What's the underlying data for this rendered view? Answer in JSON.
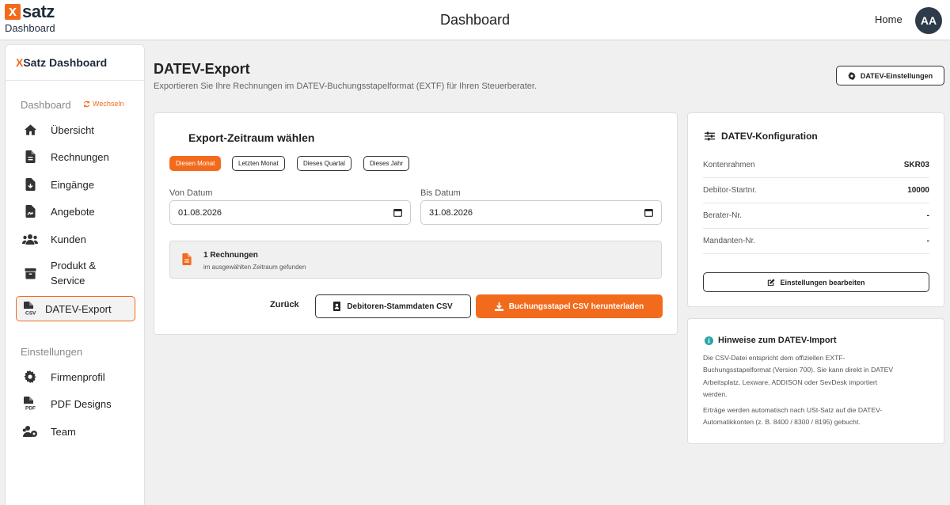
{
  "brand": {
    "logo_letter": "x",
    "logo_word": "satz",
    "subtitle": "Dashboard"
  },
  "topbar": {
    "title": "Dashboard",
    "home": "Home",
    "avatar": "AA"
  },
  "sidebar": {
    "header_x": "X",
    "header_rest": "Satz Dashboard",
    "section_dashboard": "Dashboard",
    "switch_label": "Wechseln",
    "items": [
      {
        "label": "Übersicht",
        "icon": "home-icon"
      },
      {
        "label": "Rechnungen",
        "icon": "file-icon"
      },
      {
        "label": "Eingänge",
        "icon": "file-download-icon"
      },
      {
        "label": "Angebote",
        "icon": "file-signature-icon"
      },
      {
        "label": "Kunden",
        "icon": "users-icon"
      },
      {
        "label_line1": "Produkt &",
        "label_line2": "Service",
        "icon": "box-icon"
      },
      {
        "label": "DATEV-Export",
        "icon": "file-csv-icon",
        "active": true
      }
    ],
    "section_settings": "Einstellungen",
    "settings_items": [
      {
        "label": "Firmenprofil",
        "icon": "gear-icon"
      },
      {
        "label": "PDF Designs",
        "icon": "file-pdf-icon"
      },
      {
        "label": "Team",
        "icon": "team-icon"
      }
    ]
  },
  "page": {
    "title": "DATEV-Export",
    "subtitle": "Exportieren Sie Ihre Rechnungen im DATEV-Buchungsstapelformat (EXTF) für Ihren Steuerberater.",
    "settings_button": "DATEV-Einstellungen"
  },
  "export": {
    "title": "Export-Zeitraum wählen",
    "chips": [
      "Diesen Monat",
      "Letzten Monat",
      "Dieses Quartal",
      "Dieses Jahr"
    ],
    "active_chip": 0,
    "from_label": "Von Datum",
    "from_value": "01.08.2026",
    "to_label": "Bis Datum",
    "to_value": "31.08.2026",
    "found_title": "1 Rechnungen",
    "found_sub": "im ausgewählten Zeitraum gefunden",
    "back": "Zurück",
    "csv_button": "Debitoren-Stammdaten CSV",
    "download_button": "Buchungsstapel CSV herunterladen"
  },
  "config": {
    "title": "DATEV-Konfiguration",
    "rows": [
      {
        "key": "Kontenrahmen",
        "value": "SKR03"
      },
      {
        "key": "Debitor-Startnr.",
        "value": "10000"
      },
      {
        "key": "Berater-Nr.",
        "value": "-"
      },
      {
        "key": "Mandanten-Nr.",
        "value": "-"
      }
    ],
    "edit_button": "Einstellungen bearbeiten"
  },
  "hints": {
    "title": "Hinweise zum DATEV-Import",
    "p1_l1": "Die CSV-Datei entspricht dem offiziellen EXTF-",
    "p1_l2": "Buchungsstapelformat (Version 700). Sie kann direkt in DATEV",
    "p1_l3": "Arbeitsplatz, Lexware, ADDISON oder SevDesk importiert",
    "p1_l4": "werden.",
    "p2_l1": "Erträge werden automatisch nach USt-Satz auf die DATEV-",
    "p2_l2": "Automatikkonten (z. B. 8400 / 8300 / 8195) gebucht."
  },
  "colors": {
    "accent": "#f26b1d",
    "dark": "#2d3b4a",
    "background": "#f0f0f0"
  }
}
